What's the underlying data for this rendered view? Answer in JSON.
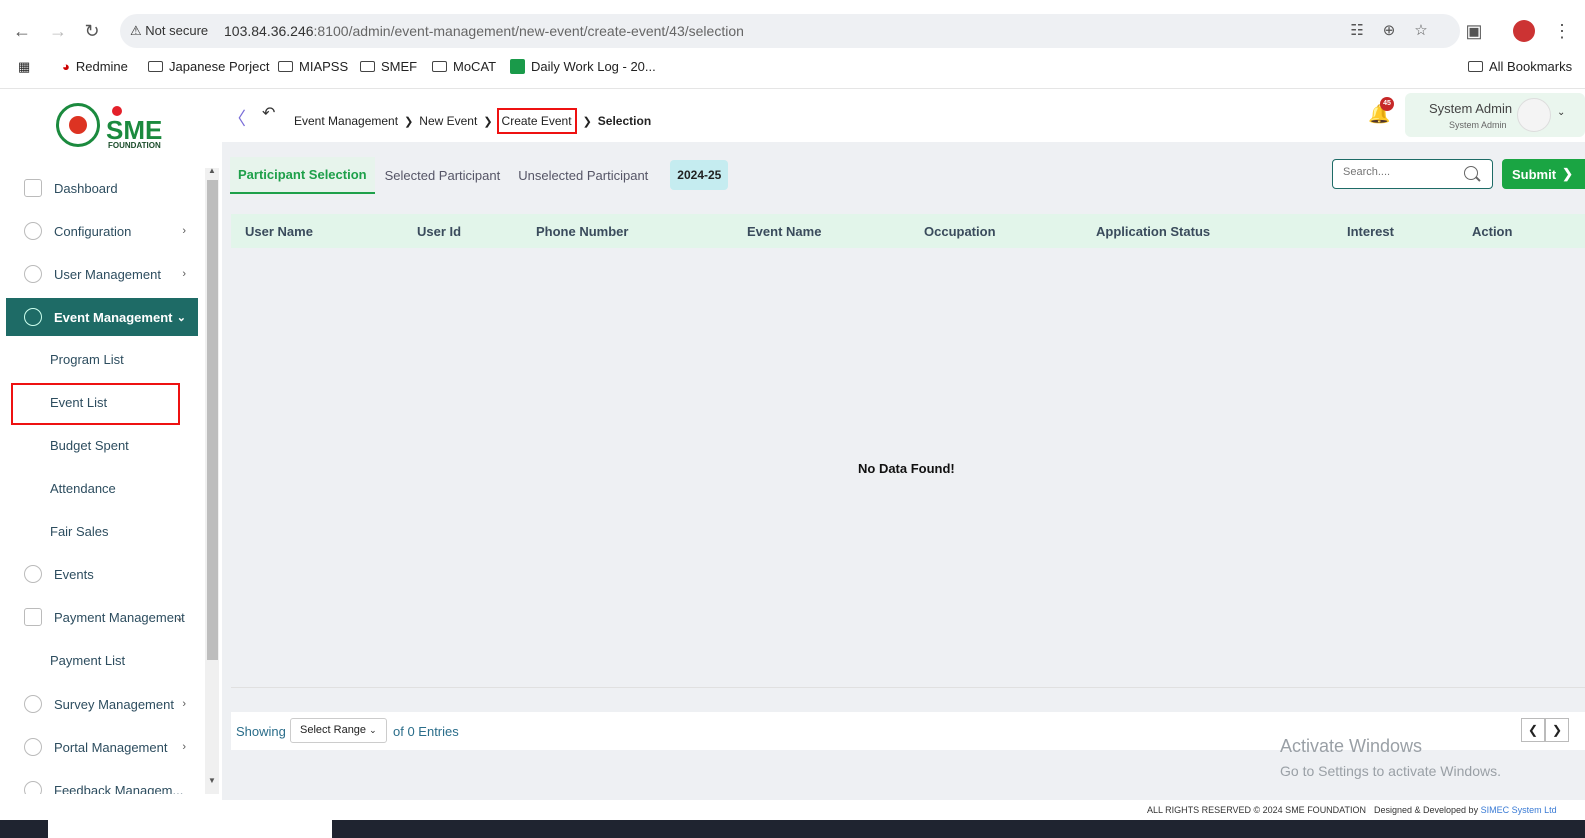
{
  "browser": {
    "security_label": "Not secure",
    "url_host": "103.84.36.246",
    "url_rest": ":8100/admin/event-management/new-event/create-event/43/selection",
    "bookmarks": [
      "Redmine",
      "Japanese Porject",
      "MIAPSS",
      "SMEF",
      "MoCAT",
      "Daily Work Log - 20..."
    ],
    "all_bookmarks": "All Bookmarks"
  },
  "header": {
    "logo_text": "SME",
    "logo_sub": "FOUNDATION",
    "breadcrumb": [
      "Event Management",
      "New Event",
      "Create Event",
      "Selection"
    ],
    "notification_count": "45",
    "user_name": "System Admin",
    "user_role": "System Admin"
  },
  "sidebar": {
    "items": [
      {
        "label": "Dashboard"
      },
      {
        "label": "Configuration"
      },
      {
        "label": "User Management"
      },
      {
        "label": "Event Management"
      },
      {
        "label": "Events"
      },
      {
        "label": "Payment Management"
      },
      {
        "label": "Survey Management"
      },
      {
        "label": "Portal Management"
      },
      {
        "label": "Feedback Managem..."
      }
    ],
    "event_sub": [
      "Program List",
      "Event List",
      "Budget Spent",
      "Attendance",
      "Fair Sales"
    ],
    "payment_sub": [
      "Payment List"
    ]
  },
  "main": {
    "tabs": [
      "Participant Selection",
      "Selected Participant",
      "Unselected Participant"
    ],
    "year": "2024-25",
    "search_placeholder": "Search....",
    "submit_label": "Submit",
    "columns": [
      "User Name",
      "User Id",
      "Phone Number",
      "Event Name",
      "Occupation",
      "Application Status",
      "Interest",
      "Action"
    ],
    "empty_message": "No Data Found!",
    "showing_label": "Showing",
    "range_label": "Select Range",
    "entries_label": "of 0 Entries"
  },
  "overlay": {
    "activate_title": "Activate Windows",
    "activate_sub": "Go to Settings to activate Windows."
  },
  "footer": {
    "rights": "ALL RIGHTS RESERVED © 2024 SME FOUNDATION",
    "designed_by": "Designed & Developed by",
    "company": "SIMEC System Ltd"
  },
  "colors": {
    "brand_green": "#1aa543",
    "sidebar_active": "#1e6b66",
    "highlight_red": "#e11111"
  }
}
